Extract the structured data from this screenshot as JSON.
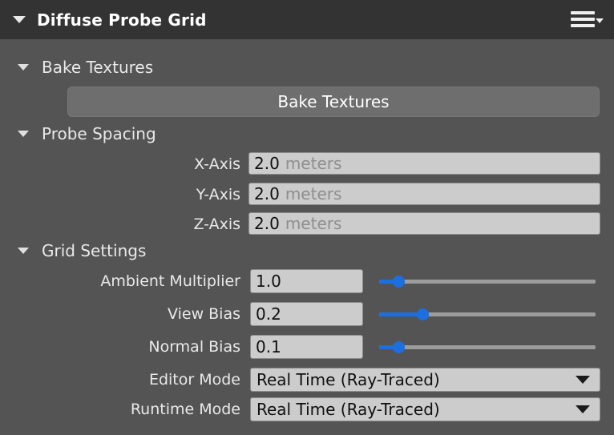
{
  "panel": {
    "title": "Diffuse Probe Grid",
    "collapse_icon": "triangle-down-icon",
    "menu_icon": "hamburger-menu-icon"
  },
  "sections": [
    {
      "id": "bake-textures",
      "label": "Bake Textures",
      "collapse_icon": "triangle-down-icon"
    },
    {
      "id": "probe-spacing",
      "label": "Probe Spacing",
      "collapse_icon": "triangle-down-icon"
    },
    {
      "id": "grid-settings",
      "label": "Grid Settings",
      "collapse_icon": "triangle-down-icon"
    }
  ],
  "bake_button": {
    "label": "Bake Textures"
  },
  "probe_spacing": {
    "rows": [
      {
        "label": "X-Axis",
        "value": "2.0",
        "unit": "meters"
      },
      {
        "label": "Y-Axis",
        "value": "2.0",
        "unit": "meters"
      },
      {
        "label": "Z-Axis",
        "value": "2.0",
        "unit": "meters"
      }
    ]
  },
  "grid_settings": {
    "sliders": [
      {
        "label": "Ambient Multiplier",
        "value": "1.0",
        "fill_percent": 9
      },
      {
        "label": "View Bias",
        "value": "0.2",
        "fill_percent": 20
      },
      {
        "label": "Normal Bias",
        "value": "0.1",
        "fill_percent": 9
      }
    ],
    "dropdowns": [
      {
        "label": "Editor Mode",
        "value": "Real Time (Ray-Traced)"
      },
      {
        "label": "Runtime Mode",
        "value": "Real Time (Ray-Traced)"
      }
    ]
  },
  "colors": {
    "panel_background": "#545454",
    "titlebar_background": "#333333",
    "field_background": "#cccccc",
    "accent_blue": "#1c6fe0",
    "text_light": "#e9e9e9"
  }
}
